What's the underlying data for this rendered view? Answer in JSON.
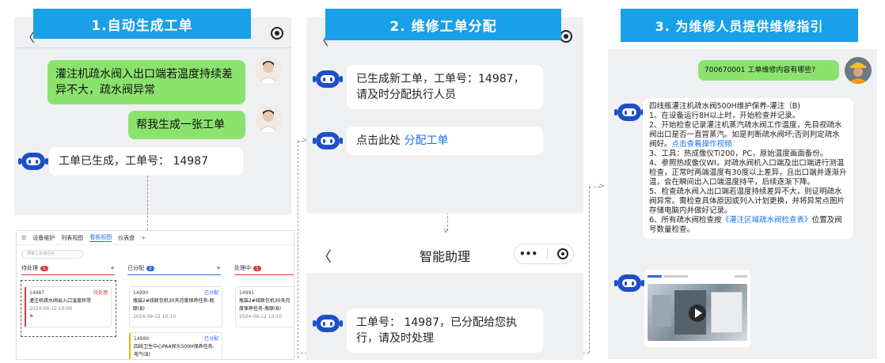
{
  "banners": {
    "b1": "1.自动生成工单",
    "b2": "2. 维修工单分配",
    "b3": "3. 为维修人员提供维修指引"
  },
  "panel1": {
    "user_msg1": "灌注机疏水阀入出口端若温度持续差异不大，疏水阀异常",
    "user_msg2": "帮我生成一张工单",
    "bot_msg": "工单已生成，工单号： 14987"
  },
  "panel2": {
    "bot_msg1": "已生成新工单，工单号：14987，请及时分配执行人员",
    "bot_msg2_prefix": "点击此处",
    "bot_msg2_link": "分配工单",
    "header_title": "智能助理",
    "bot_msg3": "工单号： 14987，已分配给您执行，请及时处理",
    "back_glyph": "〈",
    "more_glyph": "•••"
  },
  "panel3": {
    "user_msg": "700670001 工单维修内容有哪些?",
    "guide_lines": [
      "四线瓶灌注机疏水阀500H维护保养-灌注（B)",
      "1、在设备运行8H以上时，开始检查并记录。",
      "2、开始检查记录灌注机蒸汽疏水阀工作温度，先目视疏水阀出口是否一直冒蒸汽。如是判断疏水阀坏;否则判定疏水阀好。",
      "3、工具：热成像仪Ti200，PC，原始温度画面备份。",
      "4、参照热成像仪WI，对疏水阀机入口端及出口端进行测温检查，正常时两端温度有30度以上差异，且出口端并逐渐升温，会在瞬间出入口端温度持平，后续逐渐下降。",
      "5、检查疏水阀入出口端若温度持续差异不大，则证明疏水阀异常。需检查具体原因或列入计划更换，并将异常点图片存储电脑内并做好记录。",
      "6、所有疏水阀检查按",
      "位置及阀号数量检查。"
    ],
    "video_link": "点击查看操作视频",
    "table_link": "《灌注区域疏水阀检查表》"
  },
  "kanban": {
    "tabs": [
      "设备维护",
      "列表视图",
      "看板视图",
      "仪表盘"
    ],
    "search_placeholder": "搜索工单或任务",
    "columns": [
      {
        "title": "待处理",
        "count": "1"
      },
      {
        "title": "已分配",
        "count": "2"
      },
      {
        "title": "处理中",
        "count": "1"
      }
    ],
    "card1": {
      "id": "14987",
      "status": "待处理",
      "title": "灌注机疏水阀出入口温度异常",
      "date": "2024-09-12 10:06"
    },
    "card2": {
      "id": "14990",
      "status": "已分配",
      "title": "瓶装2#线联包机30天月度保养任务-瓶联(B)",
      "date": "2024-09-12 10:10"
    },
    "card3": {
      "id": "14991",
      "status": "已分配",
      "title": "瓶装2#线联包机30天月度保养任务-瓶联(B)",
      "date": "2024-09-12 10:10"
    },
    "card4": {
      "id": "14989",
      "status": "已分配",
      "title": "四线卫生中心PAA探头500H保养任务-电气(B)"
    }
  },
  "colors": {
    "banner": "#18a0e8",
    "user_bubble": "#8be36d",
    "bot": "#1f4fc8",
    "link": "#1a73e8"
  }
}
